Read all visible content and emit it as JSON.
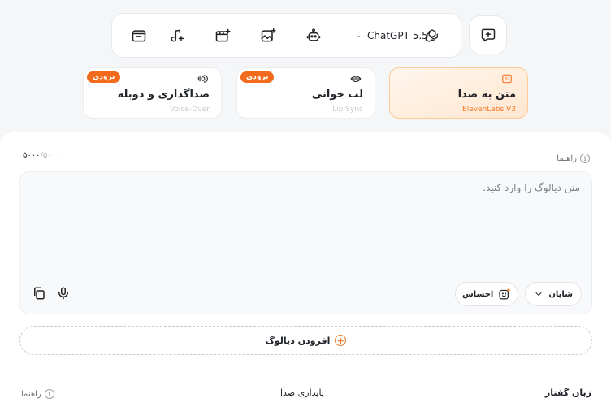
{
  "toolbar": {
    "model_label": "ChatGPT 5.5",
    "icons": [
      "folder-icon",
      "music-note-icon",
      "video-clapper-icon",
      "image-sparkle-icon",
      "robot-icon"
    ]
  },
  "modes": [
    {
      "title": "متن به صدا",
      "subtitle": "ElevenLabs V3",
      "active": true
    },
    {
      "title": "لب خوانی",
      "subtitle": "Lip Sync",
      "badge": "بزودی"
    },
    {
      "title": "صداگذاری و دوبله",
      "subtitle": "Voice-Over",
      "badge": "بزودی"
    }
  ],
  "panel": {
    "guide_label": "راهنما",
    "counter_current": "۵۰۰۰",
    "counter_max": "/۵۰۰۰",
    "dialog_placeholder": "متن دیالوگ را وارد کنید.",
    "voice_label": "شایان",
    "emotion_label": "احساس",
    "add_dialog_label": "افزودن دیالوگ",
    "language_label": "زبان گفتار",
    "stability_label": "پایداری صدا",
    "guide2_label": "راهنما"
  },
  "colors": {
    "accent": "#f07a2b",
    "badge": "#f26a1b"
  }
}
